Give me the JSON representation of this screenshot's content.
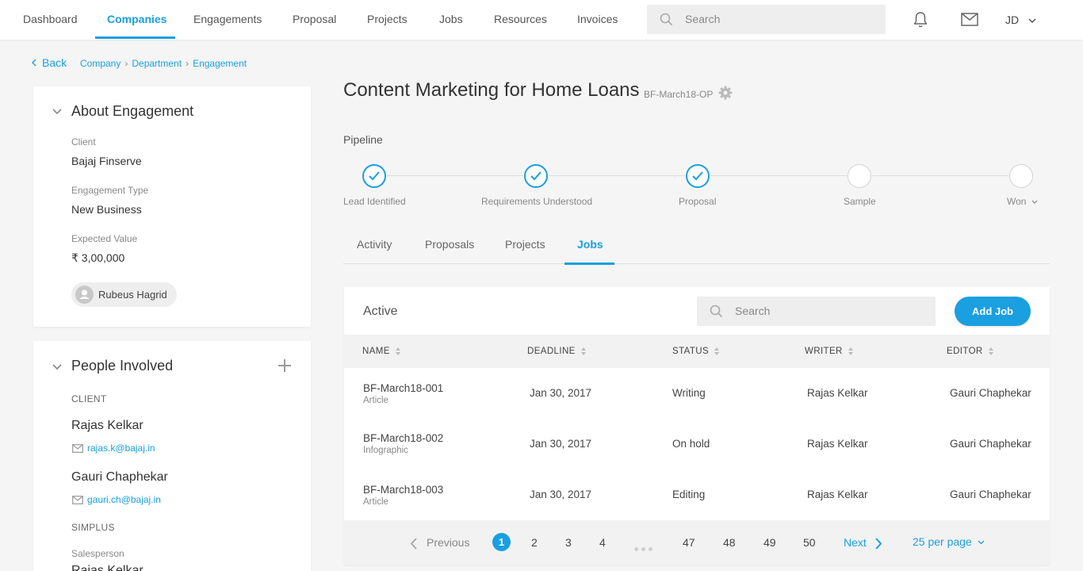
{
  "nav": {
    "items": [
      "Dashboard",
      "Companies",
      "Engagements",
      "Proposal",
      "Projects",
      "Jobs",
      "Resources",
      "Invoices"
    ],
    "active": "Companies",
    "search_placeholder": "Search",
    "user_initials": "JD"
  },
  "breadcrumb": {
    "back": "Back",
    "items": [
      "Company",
      "Department",
      "Engagement"
    ]
  },
  "about": {
    "title": "About Engagement",
    "client_label": "Client",
    "client_value": "Bajaj Finserve",
    "type_label": "Engagement Type",
    "type_value": "New Business",
    "value_label": "Expected Value",
    "value_value": "₹ 3,00,000",
    "owner": "Rubeus Hagrid"
  },
  "people": {
    "title": "People Involved",
    "client_section": "CLIENT",
    "client_people": [
      {
        "name": "Rajas Kelkar",
        "email": "rajas.k@bajaj.in"
      },
      {
        "name": "Gauri Chaphekar",
        "email": "gauri.ch@bajaj.in"
      }
    ],
    "simplus_section": "SIMPLUS",
    "salesperson_label": "Salesperson",
    "salesperson_name": "Rajas Kelkar"
  },
  "engagement": {
    "title": "Content Marketing for Home Loans",
    "code": "BF-March18-OP"
  },
  "pipeline": {
    "label": "Pipeline",
    "steps": [
      {
        "label": "Lead Identified",
        "done": true
      },
      {
        "label": "Requirements Understood",
        "done": true
      },
      {
        "label": "Proposal",
        "done": true
      },
      {
        "label": "Sample",
        "done": false
      },
      {
        "label": "Won",
        "done": false
      }
    ]
  },
  "tabs": {
    "items": [
      "Activity",
      "Proposals",
      "Projects",
      "Jobs"
    ],
    "active": "Jobs"
  },
  "jobs": {
    "title": "Active",
    "search_placeholder": "Search",
    "add_label": "Add Job",
    "columns": [
      "NAME",
      "DEADLINE",
      "STATUS",
      "WRITER",
      "EDITOR"
    ],
    "rows": [
      {
        "name": "BF-March18-001",
        "type": "Article",
        "deadline": "Jan 30, 2017",
        "status": "Writing",
        "writer": "Rajas Kelkar",
        "editor": "Gauri Chaphekar"
      },
      {
        "name": "BF-March18-002",
        "type": "Infographic",
        "deadline": "Jan 30, 2017",
        "status": "On hold",
        "writer": "Rajas Kelkar",
        "editor": "Gauri Chaphekar"
      },
      {
        "name": "BF-March18-003",
        "type": "Article",
        "deadline": "Jan 30, 2017",
        "status": "Editing",
        "writer": "Rajas Kelkar",
        "editor": "Gauri Chaphekar"
      }
    ]
  },
  "pagination": {
    "previous": "Previous",
    "next": "Next",
    "current": "1",
    "pages": [
      "2",
      "3",
      "4",
      "47",
      "48",
      "49",
      "50"
    ],
    "per_page": "25 per page"
  },
  "colors": {
    "accent": "#1a9fe0",
    "background": "#f5f5f5"
  }
}
